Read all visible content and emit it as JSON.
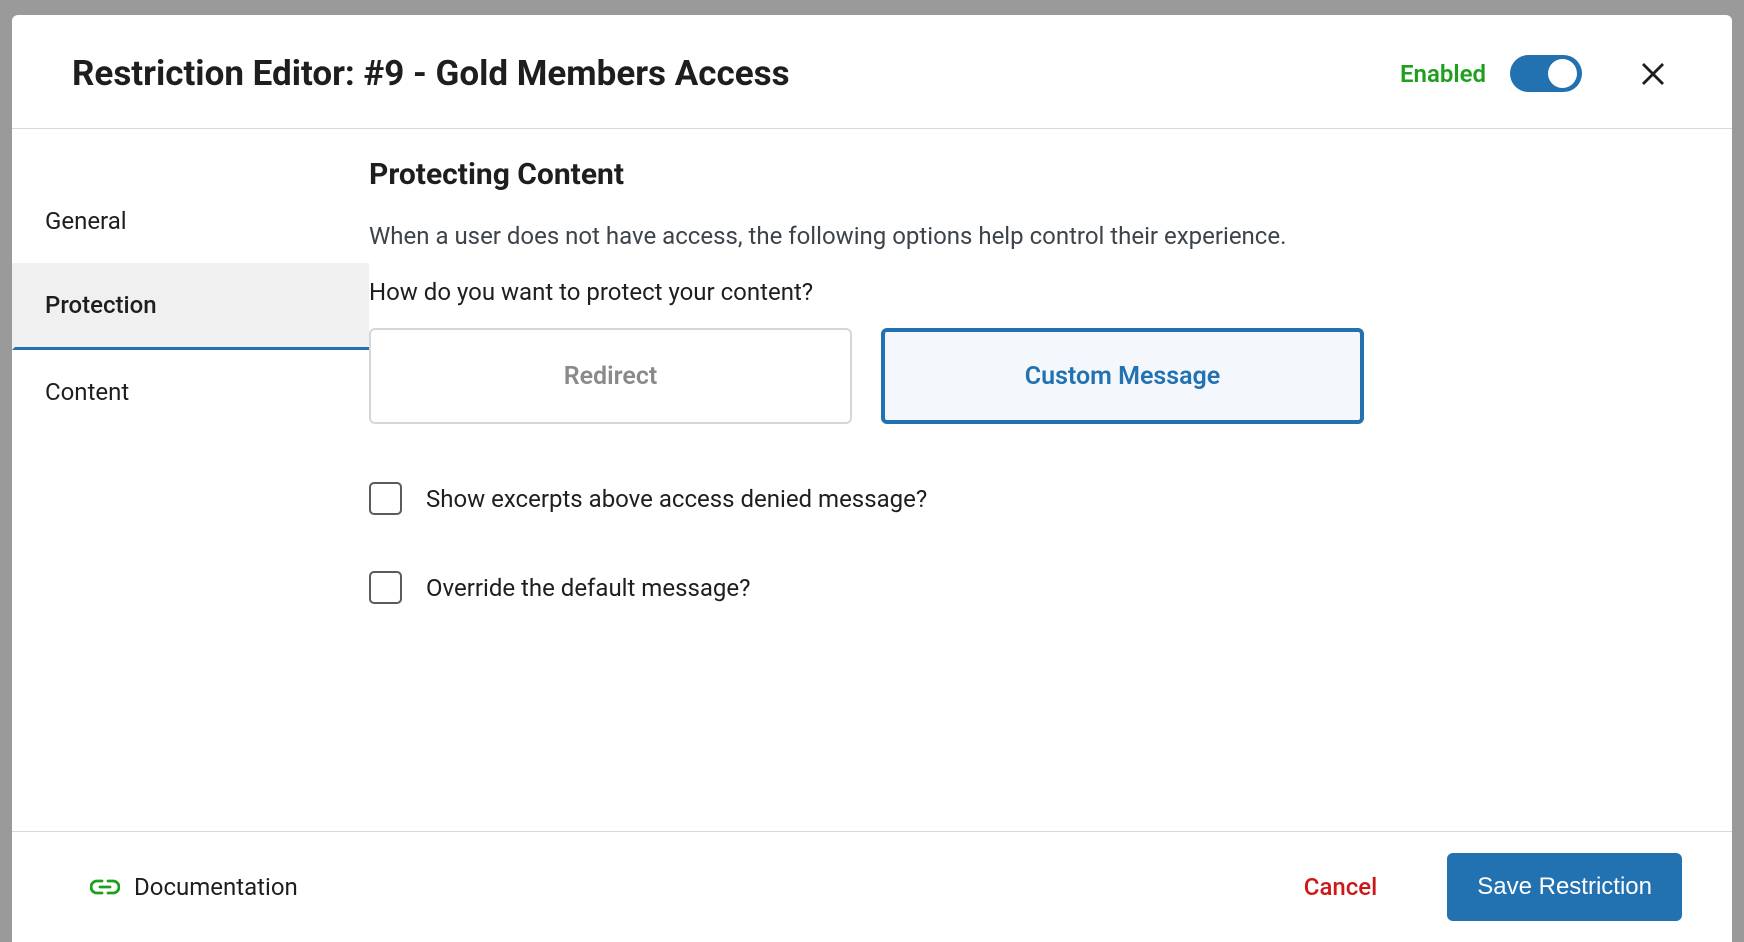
{
  "header": {
    "title": "Restriction Editor: #9 - Gold Members Access",
    "status_label": "Enabled"
  },
  "sidebar": {
    "items": [
      {
        "label": "General",
        "active": false
      },
      {
        "label": "Protection",
        "active": true
      },
      {
        "label": "Content",
        "active": false
      }
    ]
  },
  "content": {
    "section_title": "Protecting Content",
    "description": "When a user does not have access, the following options help control their experience.",
    "question": "How do you want to protect your content?",
    "options": [
      {
        "label": "Redirect",
        "selected": false
      },
      {
        "label": "Custom Message",
        "selected": true
      }
    ],
    "checkboxes": [
      {
        "label": "Show excerpts above access denied message?",
        "checked": false
      },
      {
        "label": "Override the default message?",
        "checked": false
      }
    ]
  },
  "footer": {
    "documentation_label": "Documentation",
    "cancel_label": "Cancel",
    "save_label": "Save Restriction"
  }
}
